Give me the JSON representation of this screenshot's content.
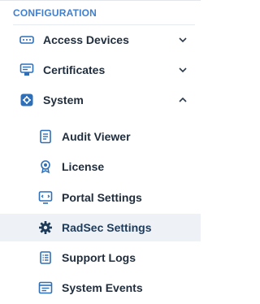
{
  "section": {
    "title": "CONFIGURATION"
  },
  "menu": {
    "top_items": [
      {
        "label": "Access Devices",
        "icon": "router-icon",
        "expanded": false
      },
      {
        "label": "Certificates",
        "icon": "certificate-icon",
        "expanded": false
      },
      {
        "label": "System",
        "icon": "gear-icon",
        "expanded": true
      }
    ],
    "system_items": [
      {
        "label": "Audit Viewer",
        "icon": "document-icon"
      },
      {
        "label": "License",
        "icon": "badge-icon"
      },
      {
        "label": "Portal Settings",
        "icon": "monitor-icon"
      },
      {
        "label": "RadSec Settings",
        "icon": "gear-icon",
        "selected": true
      },
      {
        "label": "Support Logs",
        "icon": "list-icon"
      },
      {
        "label": "System Events",
        "icon": "events-icon"
      }
    ]
  },
  "colors": {
    "accent": "#3f7fd0",
    "icon": "#2f6fb8",
    "text": "#1f2d3d",
    "selected_bg": "#eef2f7"
  }
}
